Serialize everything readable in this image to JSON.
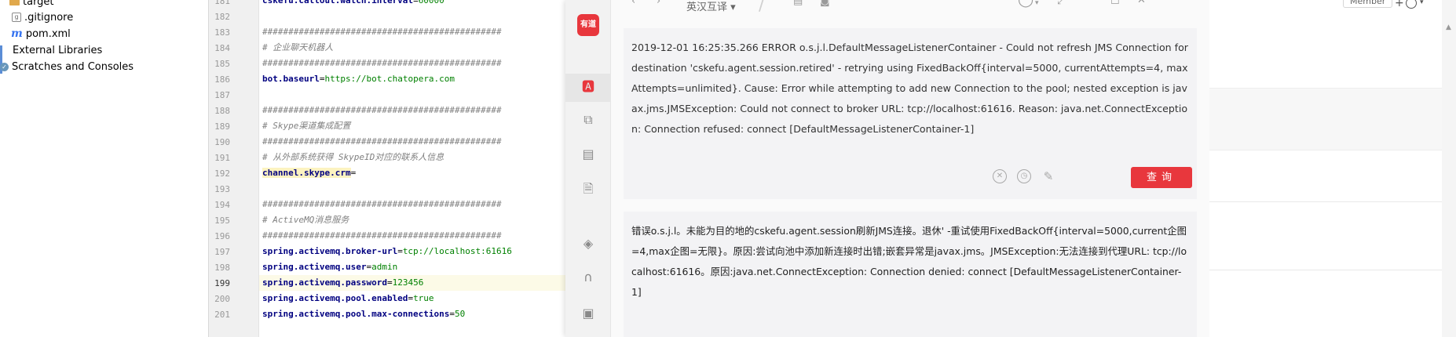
{
  "tree": {
    "items": [
      {
        "label": "target",
        "icon": "folder-icon"
      },
      {
        "label": ".gitignore",
        "icon": "gitignore-icon"
      },
      {
        "label": "pom.xml",
        "icon": "maven-icon"
      },
      {
        "label": "External Libraries",
        "icon": "library-icon"
      },
      {
        "label": "Scratches and Consoles",
        "icon": "scratch-icon"
      }
    ]
  },
  "editor": {
    "current_line": "199",
    "lines": [
      {
        "no": "181",
        "kind": "prop",
        "key": "cskefu.callout.watch.interval",
        "value": "60000"
      },
      {
        "no": "182",
        "kind": "blank",
        "text": ""
      },
      {
        "no": "183",
        "kind": "comment",
        "text": "##############################################"
      },
      {
        "no": "184",
        "kind": "comment",
        "text": "# 企业聊天机器人"
      },
      {
        "no": "185",
        "kind": "comment",
        "text": "##############################################"
      },
      {
        "no": "186",
        "kind": "prop",
        "key": "bot.baseurl",
        "value": "https://bot.chatopera.com"
      },
      {
        "no": "187",
        "kind": "blank",
        "text": ""
      },
      {
        "no": "188",
        "kind": "comment",
        "text": "##############################################"
      },
      {
        "no": "189",
        "kind": "comment",
        "text": "# Skype渠道集成配置"
      },
      {
        "no": "190",
        "kind": "comment",
        "text": "##############################################"
      },
      {
        "no": "191",
        "kind": "comment",
        "text": "# 从外部系统获得 SkypeID对应的联系人信息"
      },
      {
        "no": "192",
        "kind": "prop",
        "key": "channel.skype.crm",
        "value": ""
      },
      {
        "no": "193",
        "kind": "blank",
        "text": ""
      },
      {
        "no": "194",
        "kind": "comment",
        "text": "##############################################"
      },
      {
        "no": "195",
        "kind": "comment",
        "text": "# ActiveMQ消息服务"
      },
      {
        "no": "196",
        "kind": "comment",
        "text": "##############################################"
      },
      {
        "no": "197",
        "kind": "prop",
        "key": "spring.activemq.broker-url",
        "value": "tcp://localhost:61616"
      },
      {
        "no": "198",
        "kind": "prop",
        "key": "spring.activemq.user",
        "value": "admin"
      },
      {
        "no": "199",
        "kind": "prop",
        "key": "spring.activemq.password",
        "value": "123456"
      },
      {
        "no": "200",
        "kind": "prop",
        "key": "spring.activemq.pool.enabled",
        "value": "true"
      },
      {
        "no": "201",
        "kind": "prop",
        "key": "spring.activemq.pool.max-connections",
        "value": "50"
      }
    ]
  },
  "dict": {
    "logo": "有道",
    "direction": "英汉互译",
    "source_text": "2019-12-01 16:25:35.266 ERROR o.s.j.l.DefaultMessageListenerContainer - Could not refresh JMS Connection for destination 'cskefu.agent.session.retired' - retrying using FixedBackOff{interval=5000, currentAttempts=4, maxAttempts=unlimited}. Cause: Error while attempting to add new Connection to the pool; nested exception is javax.jms.JMSException: Could not connect to broker URL: tcp://localhost:61616. Reason: java.net.ConnectException: Connection refused: connect [DefaultMessageListenerContainer-1]",
    "query_label": "查询",
    "translation": "错误o.s.j.l。未能为目的地的cskefu.agent.session刷新JMS连接。退休' -重试使用FixedBackOff{interval=5000,current企图=4,max企图=无限}。原因:尝试向池中添加新连接时出错;嵌套异常是javax.jms。JMSException:无法连接到代理URL: tcp://localhost:61616。原因:java.net.ConnectException: Connection denied: connect [DefaultMessageListenerContainer-1]",
    "accent": "#e8373d"
  },
  "background_page": {
    "member_label": "Member",
    "plus_label": "+"
  }
}
